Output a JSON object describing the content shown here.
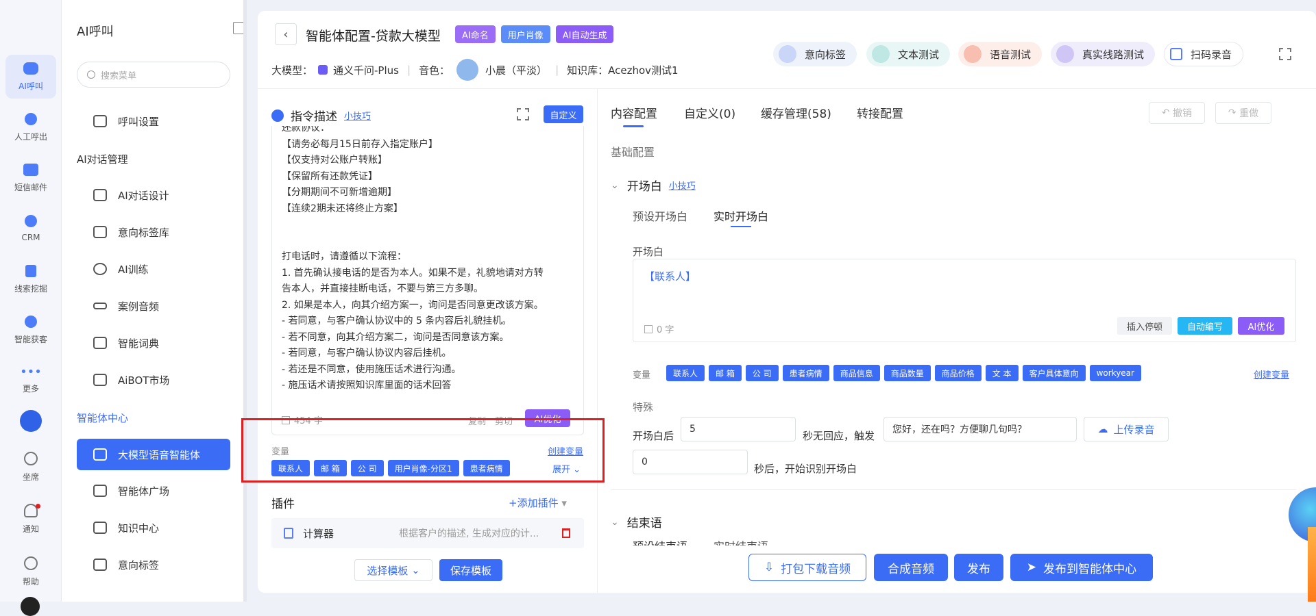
{
  "rail": {
    "items": [
      {
        "label": "AI呼叫",
        "icon": "robot-icon"
      },
      {
        "label": "人工呼出",
        "icon": "phone-out-icon"
      },
      {
        "label": "短信邮件",
        "icon": "message-icon"
      },
      {
        "label": "CRM",
        "icon": "user-icon"
      },
      {
        "label": "线索挖掘",
        "icon": "clue-icon"
      },
      {
        "label": "智能获客",
        "icon": "target-icon"
      },
      {
        "label": "更多",
        "icon": "more-icon"
      }
    ],
    "bottom": [
      {
        "label": "坐席",
        "icon": "headset-icon"
      },
      {
        "label": "通知",
        "icon": "bell-icon"
      },
      {
        "label": "帮助",
        "icon": "help-icon"
      }
    ]
  },
  "nav": {
    "title": "AI呼叫",
    "search_placeholder": "搜索菜单",
    "call_settings": "呼叫设置",
    "section_dialog": "AI对话管理",
    "dialog_items": [
      "AI对话设计",
      "意向标签库",
      "AI训练",
      "案例音频",
      "智能词典",
      "AiBOT市场"
    ],
    "section_agent": "智能体中心",
    "agent_items": [
      "大模型语音智能体",
      "智能体广场",
      "知识中心",
      "意向标签"
    ]
  },
  "header": {
    "title": "智能体配置-贷款大模型",
    "tags": [
      {
        "label": "AI命名",
        "color": "#9b6cf6"
      },
      {
        "label": "用户肖像",
        "color": "#5b8cf8"
      },
      {
        "label": "AI自动生成",
        "color": "#8b5cf6"
      }
    ],
    "model_label": "大模型：",
    "model_value": "通义千问-Plus",
    "voice_label": "音色：",
    "voice_value": "小晨（平淡）",
    "kb_label": "知识库：",
    "kb_value": "Acezhov测试1",
    "actions": [
      "意向标签",
      "文本测试",
      "语音测试",
      "真实线路测试",
      "扫码录音"
    ]
  },
  "prompt": {
    "title": "指令描述",
    "tips": "小技巧",
    "custom_btn": "自定义",
    "lines": [
      "还款协议：",
      "【请务必每月15日前存入指定账户】",
      "【仅支持对公账户转账】",
      "【保留所有还款凭证】",
      "【分期期间不可新增逾期】",
      "【连续2期未还将终止方案】",
      "",
      "",
      "打电话时，请遵循以下流程：",
      "1. 首先确认接电话的是否为本人。如果不是，礼貌地请对方转",
      "告本人，并直接挂断电话，不要与第三方多聊。",
      "2. 如果是本人，向其介绍方案一，询问是否同意更改该方案。",
      "- 若同意，与客户确认协议中的 5 条内容后礼貌挂机。",
      "- 若不同意，向其介绍方案二，询问是否同意该方案。",
      "- 若同意，与客户确认协议内容后挂机。",
      "- 若还是不同意，使用施压话术进行沟通。",
      "- 施压话术请按照知识库里面的话术回答"
    ],
    "char_count": "454 字",
    "copy": "复制",
    "cut": "剪切",
    "ai_optimize": "AI优化",
    "var_label": "变量",
    "create_var": "创建变量",
    "vars": [
      "联系人",
      "邮 箱",
      "公 司",
      "用户肖像-分区1",
      "患者病情"
    ],
    "expand": "展开",
    "plugin_label": "插件",
    "add_plugin": "+添加插件",
    "plugin_name": "计算器",
    "plugin_desc": "根据客户的描述, 生成对应的计...",
    "select_template": "选择模板",
    "save_template": "保存模板"
  },
  "config": {
    "tabs": [
      "内容配置",
      "自定义(0)",
      "缓存管理(58)",
      "转接配置"
    ],
    "undo": "撤销",
    "redo": "重做",
    "basic": "基础配置",
    "opening_title": "开场白",
    "opening_tips": "小技巧",
    "subtabs": [
      "预设开场白",
      "实时开场白"
    ],
    "opening_label": "开场白",
    "opening_text": "【联系人】",
    "opening_count": "0 字",
    "insert_pause": "插入停顿",
    "auto_write": "自动编写",
    "ai_optimize": "AI优化",
    "var_label": "变量",
    "vars": [
      "联系人",
      "邮 箱",
      "公 司",
      "患者病情",
      "商品信息",
      "商品数量",
      "商品价格",
      "文 本",
      "客户具体意向",
      "workyear"
    ],
    "create_var": "创建变量",
    "special": "特殊",
    "after_label": "开场白后",
    "after_value": "5",
    "no_reply": "秒无回应，触发",
    "reply_text": "您好，还在吗？方便聊几句吗？",
    "upload": "上传录音",
    "delay_value": "0",
    "delay_text": "秒后，开始识别开场白",
    "ending_title": "结束语",
    "ending_subtabs": [
      "预设结束语",
      "实时结束语"
    ]
  },
  "footer": {
    "download": "打包下载音频",
    "synth": "合成音频",
    "publish": "发布",
    "publish_center": "发布到智能体中心"
  },
  "colors": {
    "primary": "#3b6cf6",
    "highlight": "#e02020"
  }
}
